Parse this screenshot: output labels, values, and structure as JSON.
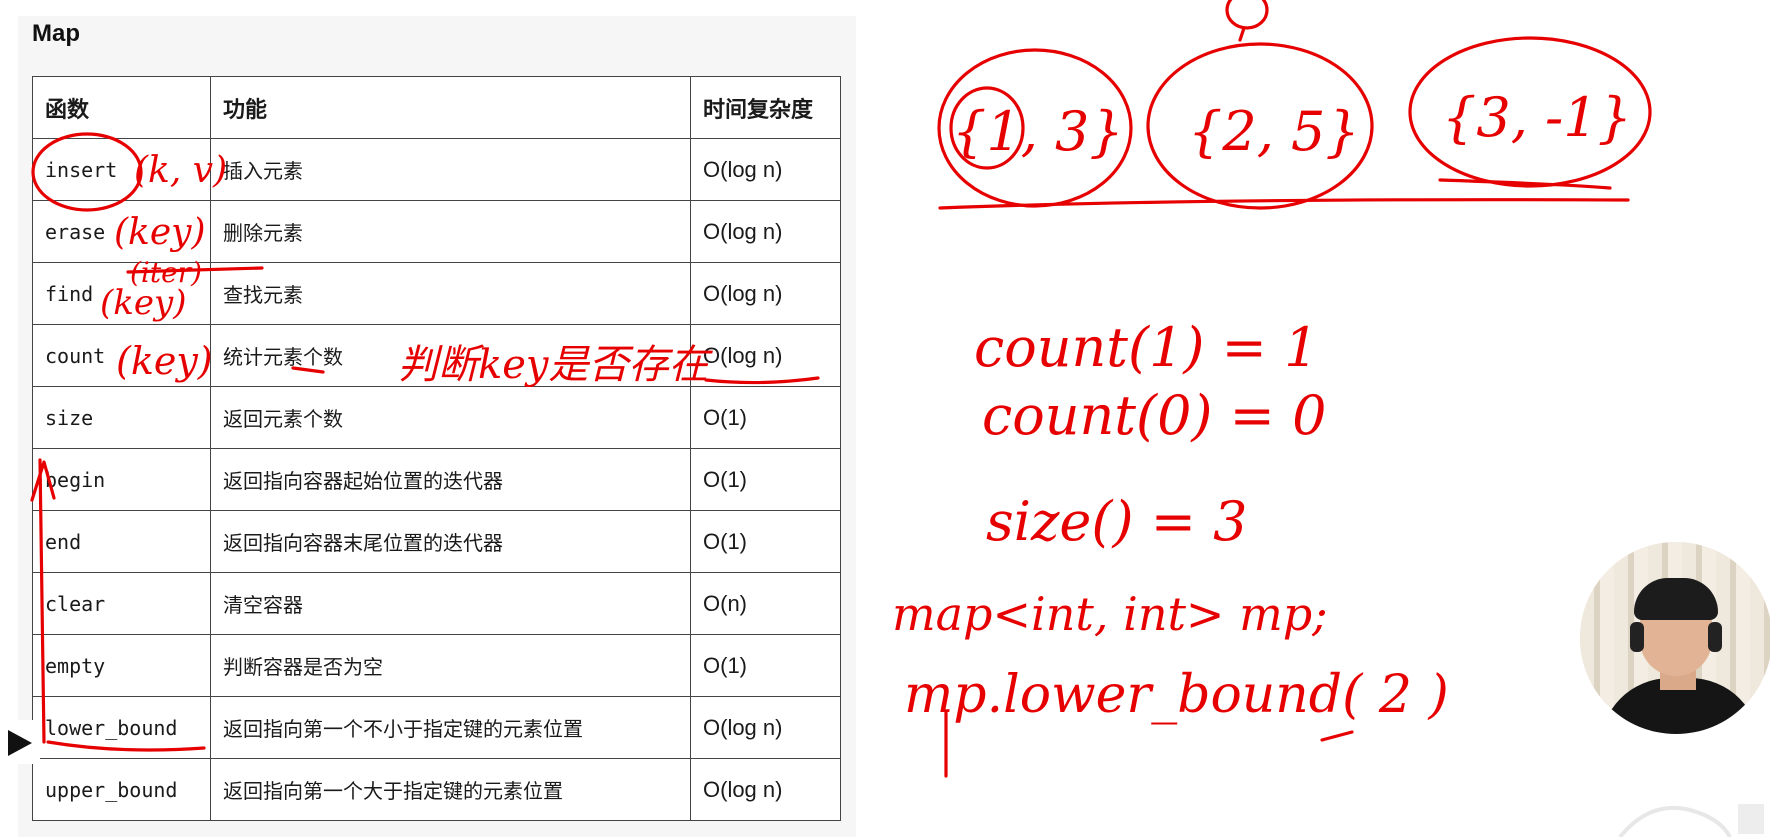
{
  "title": "Map",
  "table": {
    "headers": [
      "函数",
      "功能",
      "时间复杂度"
    ],
    "rows": [
      {
        "name": "insert",
        "desc": "插入元素",
        "complexity": "O(log n)"
      },
      {
        "name": "erase",
        "desc": "删除元素",
        "complexity": "O(log n)"
      },
      {
        "name": "find",
        "desc": "查找元素",
        "complexity": "O(log n)"
      },
      {
        "name": "count",
        "desc": "统计元素个数",
        "complexity": "O(log n)"
      },
      {
        "name": "size",
        "desc": "返回元素个数",
        "complexity": "O(1)"
      },
      {
        "name": "begin",
        "desc": "返回指向容器起始位置的迭代器",
        "complexity": "O(1)"
      },
      {
        "name": "end",
        "desc": "返回指向容器末尾位置的迭代器",
        "complexity": "O(1)"
      },
      {
        "name": "clear",
        "desc": "清空容器",
        "complexity": "O(n)"
      },
      {
        "name": "empty",
        "desc": "判断容器是否为空",
        "complexity": "O(1)"
      },
      {
        "name": "lower_bound",
        "desc": "返回指向第一个不小于指定键的元素位置",
        "complexity": "O(log n)"
      },
      {
        "name": "upper_bound",
        "desc": "返回指向第一个大于指定键的元素位置",
        "complexity": "O(log n)"
      }
    ]
  },
  "annotations": {
    "insert_args": "(k, v)",
    "erase_args": "(key)",
    "erase_iter": "(iter)",
    "find_args": "(key)",
    "count_args": "(key)",
    "count_note": "判断key是否存在",
    "pair1": "{1, 3}",
    "pair2": "{2, 5}",
    "pair3": "{3, -1}",
    "line_count1": "count(1) = 1",
    "line_count0": "count(0) = 0",
    "line_size": "size() = 3",
    "line_decl": "map<int, int> mp;",
    "line_lower": "mp.lower_bound( 2 )"
  },
  "colors": {
    "ink": "#e60000",
    "table_border": "#444444",
    "panel_bg": "#f6f6f6"
  },
  "icons": {
    "play": "play-icon"
  }
}
